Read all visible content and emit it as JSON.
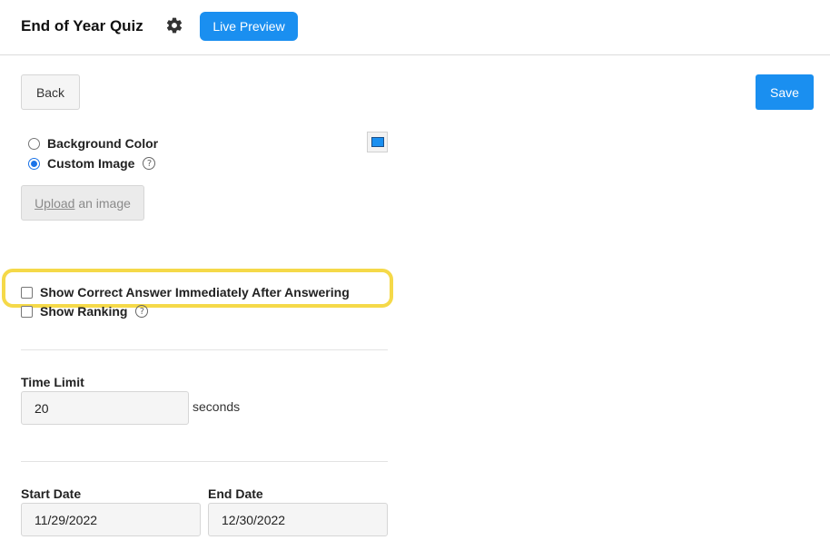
{
  "header": {
    "title": "End of Year Quiz",
    "settings_icon": "gear-icon",
    "live_preview_label": "Live Preview"
  },
  "toolbar": {
    "back_label": "Back",
    "save_label": "Save"
  },
  "background": {
    "options": [
      {
        "label": "Background Color",
        "selected": false
      },
      {
        "label": "Custom Image",
        "selected": true
      }
    ],
    "swatch_color": "#1a8ff0",
    "upload_link": "Upload",
    "upload_rest": " an image"
  },
  "options": {
    "show_correct_answer_label": "Show Correct Answer Immediately After Answering",
    "show_correct_answer_checked": false,
    "show_ranking_label": "Show Ranking",
    "show_ranking_checked": false
  },
  "time_limit": {
    "label": "Time Limit",
    "value": "20",
    "unit": "seconds"
  },
  "dates": {
    "start_label": "Start Date",
    "start_value": "11/29/2022",
    "end_label": "End Date",
    "end_value": "12/30/2022"
  },
  "colors": {
    "accent": "#1a8ff0",
    "highlight": "#f5d949"
  }
}
